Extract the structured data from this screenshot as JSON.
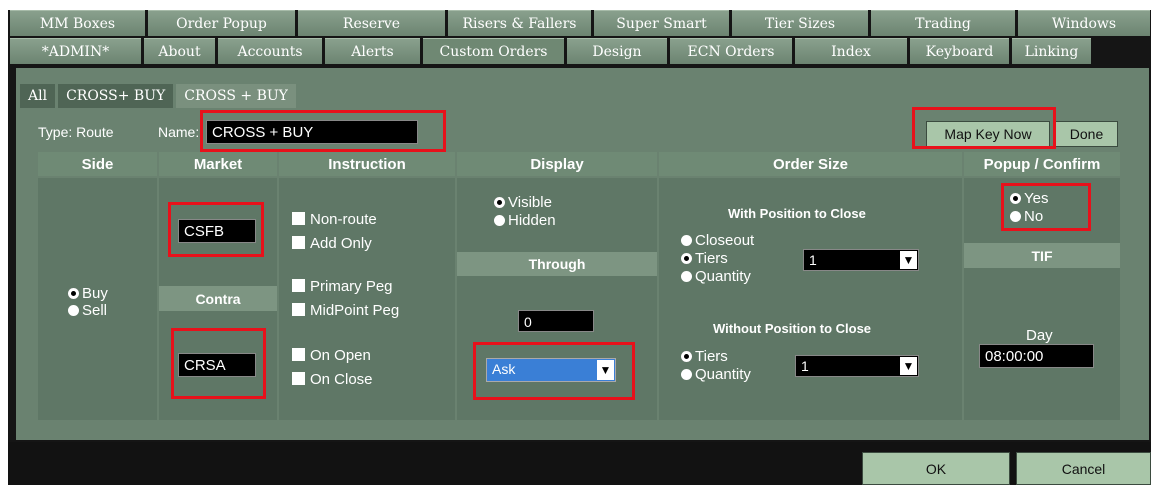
{
  "tabs_row1": [
    "MM Boxes",
    "Order Popup",
    "Reserve",
    "Risers & Fallers",
    "Super Smart",
    "Tier Sizes",
    "Trading",
    "Windows"
  ],
  "tabs_row2": [
    "*ADMIN*",
    "About",
    "Accounts",
    "Alerts",
    "Custom Orders",
    "Design",
    "ECN Orders",
    "Index",
    "Keyboard",
    "Linking"
  ],
  "subtabs": [
    "All",
    "CROSS+ BUY",
    "CROSS + BUY"
  ],
  "type_label": "Type: Route",
  "name_label": "Name:",
  "name_value": "CROSS + BUY",
  "map_key_button": "Map Key Now",
  "done_button": "Done",
  "headers": {
    "side": "Side",
    "market": "Market",
    "instruction": "Instruction",
    "display": "Display",
    "order_size": "Order Size",
    "popup_confirm": "Popup / Confirm"
  },
  "side": {
    "buy": "Buy",
    "sell": "Sell"
  },
  "market": {
    "value": "CSFB",
    "contra_label": "Contra",
    "contra_value": "CRSA"
  },
  "instruction": {
    "non_route": "Non-route",
    "add_only": "Add Only",
    "primary_peg": "Primary Peg",
    "midpoint_peg": "MidPoint Peg",
    "on_open": "On Open",
    "on_close": "On Close"
  },
  "display": {
    "visible": "Visible",
    "hidden": "Hidden",
    "through_label": "Through",
    "through_value": "0",
    "through_select": "Ask"
  },
  "order_size": {
    "with_position": "With Position to Close",
    "closeout": "Closeout",
    "tiers": "Tiers",
    "quantity": "Quantity",
    "tiers_select": "1",
    "without_position": "Without Position to Close",
    "tiers2": "Tiers",
    "quantity2": "Quantity",
    "tiers_select2": "1"
  },
  "popup_confirm": {
    "yes": "Yes",
    "no": "No",
    "tif_label": "TIF",
    "day_label": "Day",
    "time_value": "08:00:00"
  },
  "ok_button": "OK",
  "cancel_button": "Cancel",
  "colors": {
    "accent_red": "#e8111b",
    "panel": "#6a8270",
    "button": "#a9c6a9"
  }
}
